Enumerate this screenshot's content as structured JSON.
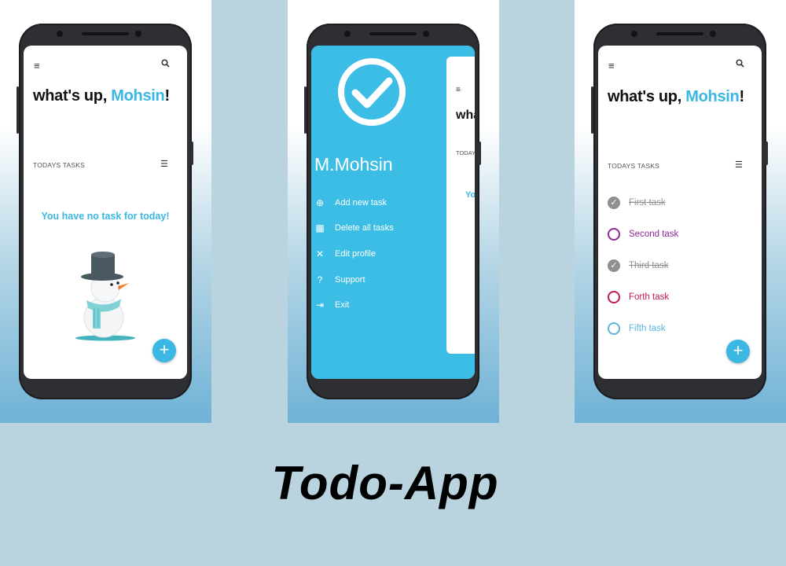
{
  "title": "Todo-App",
  "screen_home_empty": {
    "greeting_prefix": "what's up,",
    "greeting_name": "Mohsin",
    "greeting_suffix": "!",
    "section_label": "TODAYS TASKS",
    "empty_message": "You have no task for today!",
    "fab_label": "+"
  },
  "screen_drawer": {
    "profile_name": "M.Mohsin",
    "menu": [
      {
        "label": "Add new task",
        "icon": "add-circle-icon"
      },
      {
        "label": "Delete all tasks",
        "icon": "delete-icon"
      },
      {
        "label": "Edit profile",
        "icon": "edit-icon"
      },
      {
        "label": "Support",
        "icon": "help-icon"
      },
      {
        "label": "Exit",
        "icon": "exit-icon"
      }
    ],
    "peek_greeting": "wha",
    "peek_section": "TODAY",
    "peek_empty": "Yo"
  },
  "screen_home_tasks": {
    "greeting_prefix": "what's up,",
    "greeting_name": "Mohsin",
    "greeting_suffix": "!",
    "section_label": "TODAYS TASKS",
    "tasks": [
      {
        "label": "First task",
        "done": true,
        "color": "#8f8f8f"
      },
      {
        "label": "Second task",
        "done": false,
        "color": "#8e2a96"
      },
      {
        "label": "Third task",
        "done": true,
        "color": "#8f8f8f"
      },
      {
        "label": "Forth task",
        "done": false,
        "color": "#c2185b"
      },
      {
        "label": "Fifth task",
        "done": false,
        "color": "#5ab4dc"
      }
    ],
    "fab_label": "+"
  },
  "colors": {
    "accent": "#3bb7e4",
    "drawer": "#3bbde6",
    "background": "#b9d3df"
  }
}
